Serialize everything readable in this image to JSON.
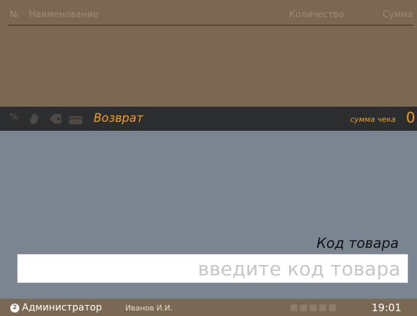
{
  "table": {
    "columns": {
      "number": "№",
      "name": "Наименование",
      "quantity": "Количество",
      "sum": "Сумма"
    },
    "rows": []
  },
  "status_bar": {
    "icons": [
      "percent-icon",
      "hand-icon",
      "tag-icon",
      "card-icon"
    ],
    "percent_symbol": "%",
    "mode": "Возврат",
    "sum_label": "сумма чека",
    "sum_value": "0"
  },
  "input": {
    "label": "Код товара",
    "value": "",
    "placeholder": "введите код товара"
  },
  "bottom_bar": {
    "role_number": "2",
    "role": "Администратор",
    "user": "Иванов И.И.",
    "device_icons": [
      "printer-icon",
      "scanner-icon",
      "display-icon",
      "network-icon",
      "sync-icon"
    ],
    "time": "19:01"
  },
  "colors": {
    "table_bg": "#7a6853",
    "status_bg": "#2c2d2e",
    "accent": "#f0a020",
    "workspace_bg": "#7a8591"
  }
}
